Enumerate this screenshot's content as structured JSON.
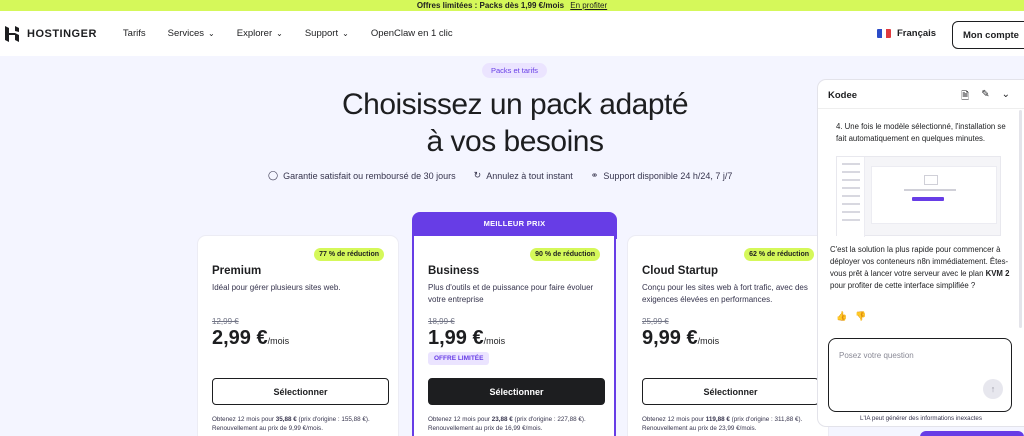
{
  "promo": {
    "text": "Offres limitées : Packs dès 1,99 €/mois",
    "link": "En profiter"
  },
  "nav": {
    "brand": "HOSTINGER",
    "items": [
      {
        "label": "Tarifs",
        "chevron": false
      },
      {
        "label": "Services",
        "chevron": true
      },
      {
        "label": "Explorer",
        "chevron": true
      },
      {
        "label": "Support",
        "chevron": true
      },
      {
        "label": "OpenClaw en 1 clic",
        "chevron": false
      }
    ],
    "language": "Français",
    "account": "Mon compte"
  },
  "hero": {
    "pill": "Packs et tarifs",
    "title_line1": "Choisissez un pack adapté",
    "title_line2": "à vos besoins",
    "guarantees": [
      {
        "icon": "shield-icon",
        "text": "Garantie satisfait ou remboursé de 30 jours"
      },
      {
        "icon": "refresh-icon",
        "text": "Annulez à tout instant"
      },
      {
        "icon": "headset-icon",
        "text": "Support disponible 24 h/24, 7 j/7"
      }
    ]
  },
  "plans": [
    {
      "discount": "77 % de réduction",
      "name": "Premium",
      "description": "Idéal pour gérer plusieurs sites web.",
      "old_price": "12,99 €",
      "price": "2,99 €",
      "per": "/mois",
      "limited": "",
      "cta": "Sélectionner",
      "fine_a": "Obtenez 12 mois pour ",
      "fine_b": "35,88 €",
      "fine_c": " (prix d'origine : 155,88 €). Renouvellement au prix de 9,99 €/mois."
    },
    {
      "badge": "MEILLEUR PRIX",
      "discount": "90 % de réduction",
      "name": "Business",
      "description": "Plus d'outils et de puissance pour faire évoluer votre entreprise",
      "old_price": "18,99 €",
      "price": "1,99 €",
      "per": "/mois",
      "limited": "OFFRE LIMITÉE",
      "cta": "Sélectionner",
      "fine_a": "Obtenez 12 mois pour ",
      "fine_b": "23,88 €",
      "fine_c": " (prix d'origine : 227,88 €). Renouvellement au prix de 16,99 €/mois."
    },
    {
      "discount": "62 % de réduction",
      "name": "Cloud Startup",
      "description": "Conçu pour les sites web à fort trafic, avec des exigences élevées en performances.",
      "old_price": "25,99 €",
      "price": "9,99 €",
      "per": "/mois",
      "limited": "",
      "cta": "Sélectionner",
      "fine_a": "Obtenez 12 mois pour ",
      "fine_b": "119,88 €",
      "fine_c": " (prix d'origine : 311,88 €). Renouvellement au prix de 23,99 €/mois."
    }
  ],
  "chat": {
    "title": "Kodee",
    "step": "4. Une fois le modèle sélectionné, l'installation se fait automatiquement en quelques minutes.",
    "answer_a": "C'est la solution la plus rapide pour commencer à déployer vos conteneurs n8n immédiatement. Êtes-vous prêt à lancer votre serveur avec le plan ",
    "answer_b": "KVM 2",
    "answer_c": " pour profiter de cette interface simplifiée ?",
    "placeholder": "Posez votre question",
    "disclaimer": "L'IA peut générer des informations inexactes"
  },
  "colors": {
    "accent": "#673de6",
    "promo": "#d5f85a",
    "background": "#f4f5ff",
    "text": "#1d1e20"
  }
}
